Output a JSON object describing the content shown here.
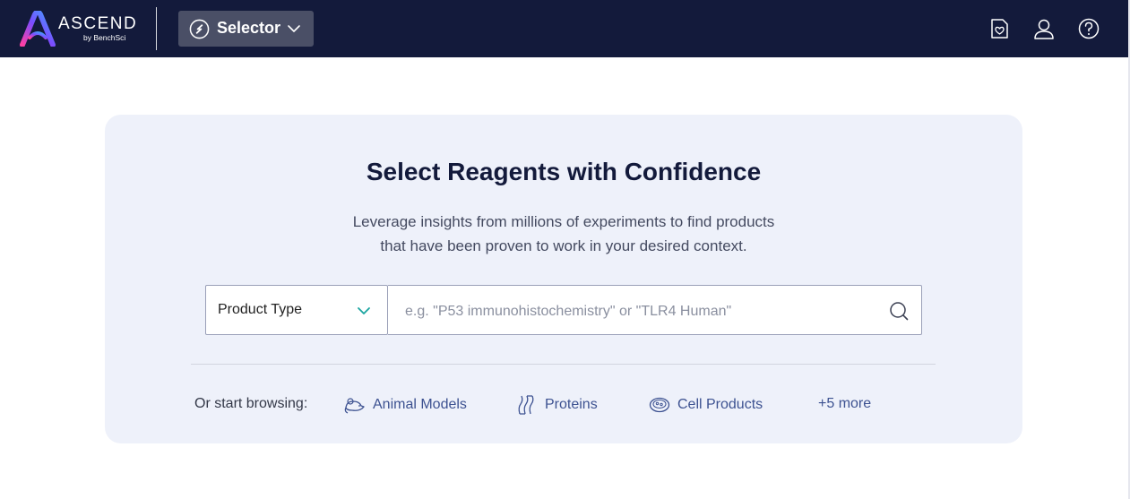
{
  "header": {
    "logo_word": "ASCEND",
    "logo_sub": "by BenchSci",
    "module_label": "Selector",
    "icons": [
      "saved-list-icon",
      "user-icon",
      "help-icon"
    ]
  },
  "hero": {
    "title": "Select Reagents with Confidence",
    "subtitle_line1": "Leverage insights from millions of experiments to find products",
    "subtitle_line2": "that have been proven to work in your desired context."
  },
  "search": {
    "product_type_label": "Product Type",
    "placeholder": "e.g. \"P53 immunohistochemistry\" or \"TLR4 Human\"",
    "value": ""
  },
  "browse": {
    "label": "Or start browsing:",
    "items": [
      {
        "label": "Animal Models",
        "icon": "mouse-icon"
      },
      {
        "label": "Proteins",
        "icon": "protein-icon"
      },
      {
        "label": "Cell Products",
        "icon": "petri-dish-icon"
      }
    ],
    "more_label": "+5 more"
  },
  "colors": {
    "topbar": "#131a3b",
    "hero_bg": "#eef1fa",
    "accent_teal": "#1aa5a0",
    "link": "#3d5291",
    "logo_gradient": [
      "#ff3fa4",
      "#7a4dff",
      "#3fa8ff"
    ]
  }
}
